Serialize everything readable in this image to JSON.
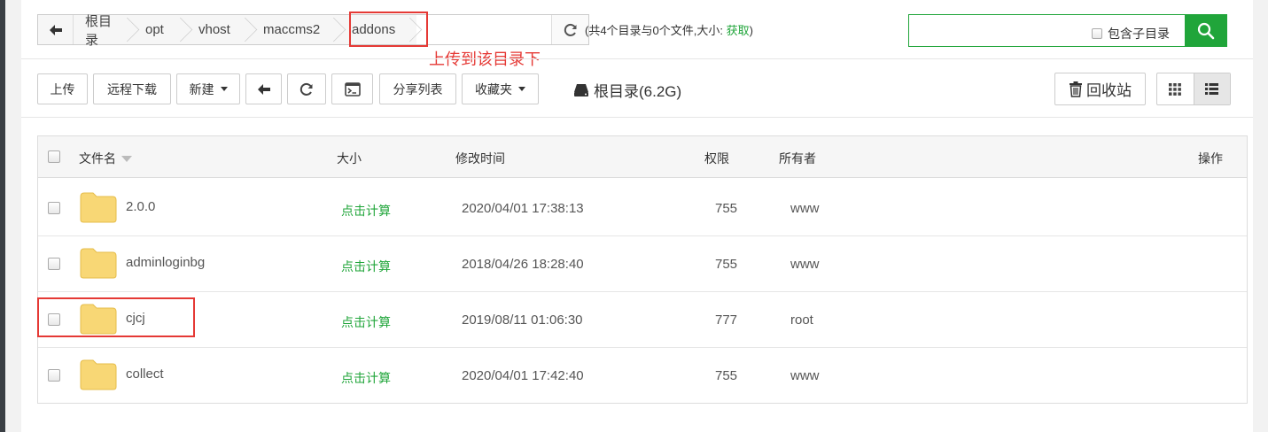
{
  "path": {
    "crumbs": [
      "根目录",
      "opt",
      "vhost",
      "maccms2",
      "addons"
    ]
  },
  "summary": {
    "text": "(共4个目录与0个文件,大小: ",
    "fetch_label": "获取",
    "suffix": ")"
  },
  "search": {
    "value": "",
    "include_subdir_label": "包含子目录"
  },
  "annotation": "上传到该目录下",
  "toolbar": {
    "upload": "上传",
    "remote_download": "远程下载",
    "new": "新建",
    "share_list": "分享列表",
    "favorites": "收藏夹",
    "disk_label": "根目录(6.2G)",
    "recycle_bin": "回收站"
  },
  "table": {
    "headers": {
      "name": "文件名",
      "size": "大小",
      "mtime": "修改时间",
      "perm": "权限",
      "owner": "所有者",
      "actions": "操作"
    },
    "rows": [
      {
        "name": "2.0.0",
        "size": "点击计算",
        "mtime": "2020/04/01 17:38:13",
        "perm": "755",
        "owner": "www"
      },
      {
        "name": "adminloginbg",
        "size": "点击计算",
        "mtime": "2018/04/26 18:28:40",
        "perm": "755",
        "owner": "www"
      },
      {
        "name": "cjcj",
        "size": "点击计算",
        "mtime": "2019/08/11 01:06:30",
        "perm": "777",
        "owner": "root"
      },
      {
        "name": "collect",
        "size": "点击计算",
        "mtime": "2020/04/01 17:42:40",
        "perm": "755",
        "owner": "www"
      }
    ]
  },
  "icons": {
    "back": "arrow-left-icon",
    "refresh": "refresh-icon",
    "search": "search-icon",
    "terminal": "terminal-icon",
    "disk": "hdd-icon",
    "trash": "trash-icon",
    "grid": "grid-view-icon",
    "list": "list-view-icon",
    "folder": "folder-icon"
  },
  "colors": {
    "accent": "#20a53a",
    "highlight": "#e53935",
    "folder": "#f8d775"
  }
}
